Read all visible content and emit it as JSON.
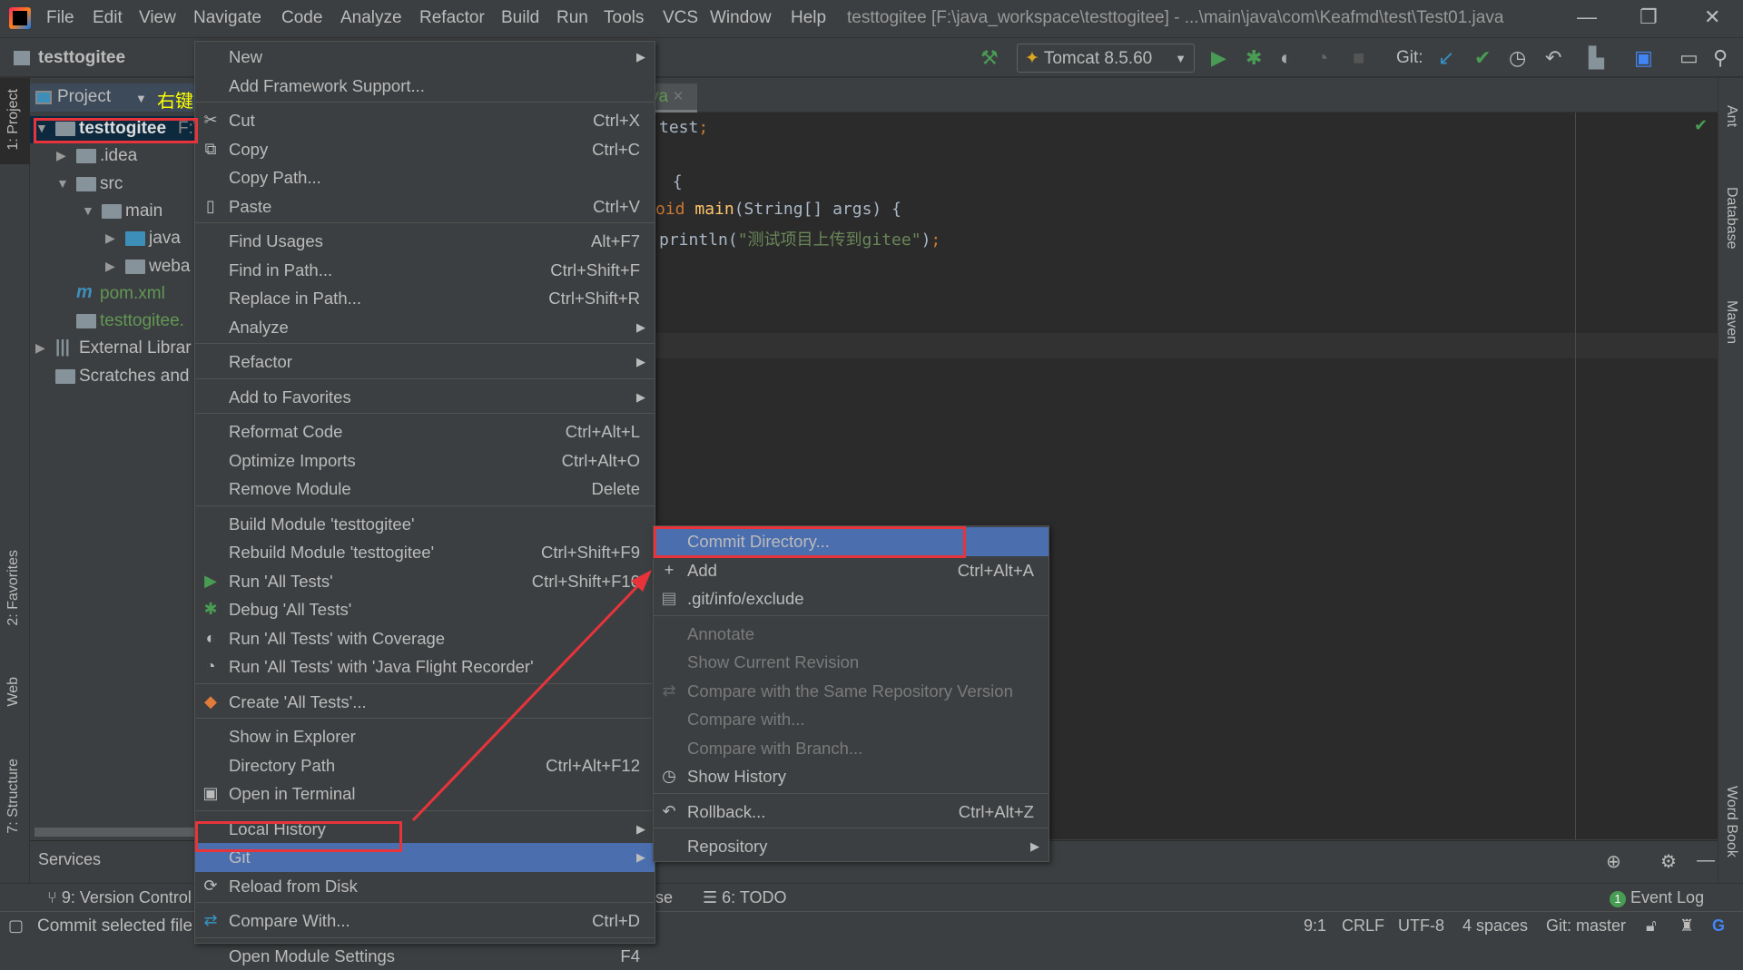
{
  "window": {
    "title": "testtogitee [F:\\java_workspace\\testtogitee] - ...\\main\\java\\com\\Keafmd\\test\\Test01.java"
  },
  "menubar": [
    "File",
    "Edit",
    "View",
    "Navigate",
    "Code",
    "Analyze",
    "Refactor",
    "Build",
    "Run",
    "Tools",
    "VCS",
    "Window",
    "Help"
  ],
  "navbar": {
    "project": "testtogitee",
    "run_config": "Tomcat 8.5.60",
    "git_label": "Git:"
  },
  "left_strip": {
    "project": "1: Project",
    "favorites": "2: Favorites",
    "web": "Web",
    "structure": "7: Structure"
  },
  "right_strip": {
    "ant": "Ant",
    "database": "Database",
    "maven": "Maven",
    "wordbook": "Word Book"
  },
  "project_panel": {
    "title": "Project",
    "annotation": "右键",
    "tree": [
      {
        "label": "testtogitee",
        "suffix": "F:\\",
        "depth": 0,
        "arrow": "down",
        "icon": "module-folder",
        "selected": true
      },
      {
        "label": ".idea",
        "depth": 1,
        "arrow": "right",
        "icon": "folder"
      },
      {
        "label": "src",
        "depth": 1,
        "arrow": "down",
        "icon": "folder"
      },
      {
        "label": "main",
        "depth": 2,
        "arrow": "down",
        "icon": "folder"
      },
      {
        "label": "java",
        "depth": 3,
        "arrow": "right",
        "icon": "source-folder"
      },
      {
        "label": "weba",
        "depth": 3,
        "arrow": "right",
        "icon": "web-folder"
      },
      {
        "label": "pom.xml",
        "depth": 1,
        "icon": "maven-file",
        "color": "#629755"
      },
      {
        "label": "testtogitee.",
        "depth": 1,
        "icon": "iml-file",
        "color": "#629755"
      },
      {
        "label": "External Librar",
        "depth": 0,
        "arrow": "right",
        "icon": "libraries"
      },
      {
        "label": "Scratches and",
        "depth": 0,
        "icon": "scratches"
      }
    ]
  },
  "editor": {
    "tab_fragment": "va",
    "code": [
      {
        "parts": [
          {
            "t": "test",
            "c": "#a9b7c6"
          },
          {
            "t": ";",
            "c": "#cc7832"
          }
        ]
      },
      {
        "parts": []
      },
      {
        "parts": [
          {
            "t": " {",
            "c": "#a9b7c6"
          }
        ]
      },
      {
        "parts": [
          {
            "t": "oid ",
            "c": "#cc7832"
          },
          {
            "t": "main",
            "c": "#ffc66d"
          },
          {
            "t": "(String[] args) {",
            "c": "#a9b7c6"
          }
        ]
      },
      {
        "parts": [
          {
            "t": "println(",
            "c": "#a9b7c6"
          },
          {
            "t": "\"测试项目上传到gitee\"",
            "c": "#6a8759"
          },
          {
            "t": ")",
            "c": "#a9b7c6"
          },
          {
            "t": ";",
            "c": "#cc7832"
          }
        ]
      }
    ]
  },
  "bottom": {
    "services": "Services",
    "version_control": "9: Version Control",
    "hidden_fragment": "se",
    "todo": "6: TODO",
    "event_log": "Event Log",
    "event_count": "1"
  },
  "statusbar": {
    "message": "Commit selected file",
    "position": "9:1",
    "line_sep": "CRLF",
    "encoding": "UTF-8",
    "indent": "4 spaces",
    "branch": "Git: master"
  },
  "context_menu": [
    {
      "label": "New",
      "submenu": true
    },
    {
      "label": "Add Framework Support..."
    },
    {
      "sep": true
    },
    {
      "label": "Cut",
      "shortcut": "Ctrl+X",
      "icon": "cut"
    },
    {
      "label": "Copy",
      "shortcut": "Ctrl+C",
      "icon": "copy"
    },
    {
      "label": "Copy Path..."
    },
    {
      "label": "Paste",
      "shortcut": "Ctrl+V",
      "icon": "paste"
    },
    {
      "sep": true
    },
    {
      "label": "Find Usages",
      "shortcut": "Alt+F7"
    },
    {
      "label": "Find in Path...",
      "shortcut": "Ctrl+Shift+F"
    },
    {
      "label": "Replace in Path...",
      "shortcut": "Ctrl+Shift+R"
    },
    {
      "label": "Analyze",
      "submenu": true
    },
    {
      "sep": true
    },
    {
      "label": "Refactor",
      "submenu": true
    },
    {
      "sep": true
    },
    {
      "label": "Add to Favorites",
      "submenu": true
    },
    {
      "sep": true
    },
    {
      "label": "Reformat Code",
      "shortcut": "Ctrl+Alt+L"
    },
    {
      "label": "Optimize Imports",
      "shortcut": "Ctrl+Alt+O"
    },
    {
      "label": "Remove Module",
      "shortcut": "Delete"
    },
    {
      "sep": true
    },
    {
      "label": "Build Module 'testtogitee'"
    },
    {
      "label": "Rebuild Module 'testtogitee'",
      "shortcut": "Ctrl+Shift+F9"
    },
    {
      "label": "Run 'All Tests'",
      "shortcut": "Ctrl+Shift+F10",
      "icon": "run"
    },
    {
      "label": "Debug 'All Tests'",
      "icon": "debug"
    },
    {
      "label": "Run 'All Tests' with Coverage",
      "icon": "coverage"
    },
    {
      "label": "Run 'All Tests' with 'Java Flight Recorder'",
      "icon": "profiler"
    },
    {
      "sep": true
    },
    {
      "label": "Create 'All Tests'...",
      "icon": "create"
    },
    {
      "sep": true
    },
    {
      "label": "Show in Explorer"
    },
    {
      "label": "Directory Path",
      "shortcut": "Ctrl+Alt+F12"
    },
    {
      "label": "Open in Terminal",
      "icon": "terminal"
    },
    {
      "sep": true
    },
    {
      "label": "Local History",
      "submenu": true
    },
    {
      "label": "Git",
      "submenu": true,
      "highlighted": true
    },
    {
      "label": "Reload from Disk",
      "icon": "reload"
    },
    {
      "sep": true
    },
    {
      "label": "Compare With...",
      "shortcut": "Ctrl+D",
      "icon": "compare"
    },
    {
      "sep": true
    },
    {
      "label": "Open Module Settings",
      "shortcut": "F4"
    }
  ],
  "git_submenu": [
    {
      "label": "Commit Directory...",
      "highlighted": true
    },
    {
      "label": "Add",
      "shortcut": "Ctrl+Alt+A",
      "icon": "plus"
    },
    {
      "label": ".git/info/exclude",
      "icon": "exclude"
    },
    {
      "sep": true
    },
    {
      "label": "Annotate",
      "disabled": true
    },
    {
      "label": "Show Current Revision",
      "disabled": true
    },
    {
      "label": "Compare with the Same Repository Version",
      "disabled": true,
      "icon": "compare"
    },
    {
      "label": "Compare with...",
      "disabled": true
    },
    {
      "label": "Compare with Branch...",
      "disabled": true
    },
    {
      "label": "Show History",
      "icon": "history"
    },
    {
      "sep": true
    },
    {
      "label": "Rollback...",
      "shortcut": "Ctrl+Alt+Z",
      "icon": "rollback"
    },
    {
      "sep": true
    },
    {
      "label": "Repository",
      "submenu": true
    }
  ],
  "colors": {
    "highlight": "#4b6eaf",
    "annotation_red": "#e8333b",
    "annotation_yellow": "#ffff00",
    "green": "#499c54"
  }
}
